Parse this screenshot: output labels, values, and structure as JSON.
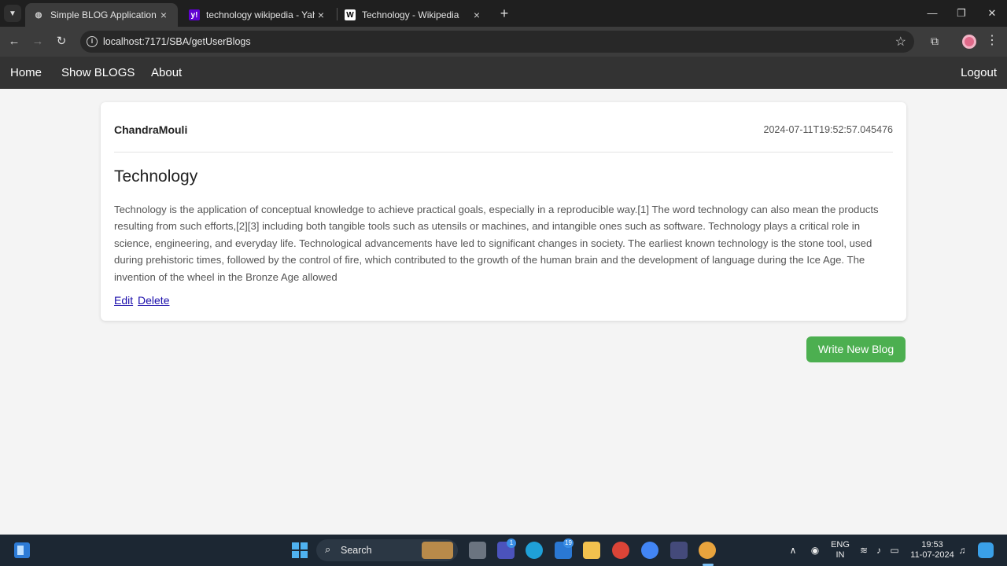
{
  "browser": {
    "tabs": [
      {
        "title": "Simple BLOG Application",
        "active": true
      },
      {
        "title": "technology wikipedia - Yahoo In",
        "active": false
      },
      {
        "title": "Technology - Wikipedia",
        "active": false
      }
    ],
    "url": "localhost:7171/SBA/getUserBlogs"
  },
  "nav": {
    "home": "Home",
    "show_blogs": "Show BLOGS",
    "about": "About",
    "logout": "Logout"
  },
  "blog": {
    "author": "ChandraMouli",
    "timestamp": "2024-07-11T19:52:57.045476",
    "title": "Technology",
    "body": "Technology is the application of conceptual knowledge to achieve practical goals, especially in a reproducible way.[1] The word technology can also mean the products resulting from such efforts,[2][3] including both tangible tools such as utensils or machines, and intangible ones such as software. Technology plays a critical role in science, engineering, and everyday life. Technological advancements have led to significant changes in society. The earliest known technology is the stone tool, used during prehistoric times, followed by the control of fire, which contributed to the growth of the human brain and the development of language during the Ice Age. The invention of the wheel in the Bronze Age allowed",
    "edit": "Edit",
    "delete": "Delete"
  },
  "write_button": "Write New Blog",
  "taskbar": {
    "search": "Search",
    "teams_badge": "1",
    "mail_badge": "19",
    "lang_line1": "ENG",
    "lang_line2": "IN",
    "time": "19:53",
    "date": "11-07-2024"
  },
  "colors": {
    "nav_bg": "#333333",
    "button_green": "#4caf50",
    "link_blue": "#1a0dab"
  }
}
